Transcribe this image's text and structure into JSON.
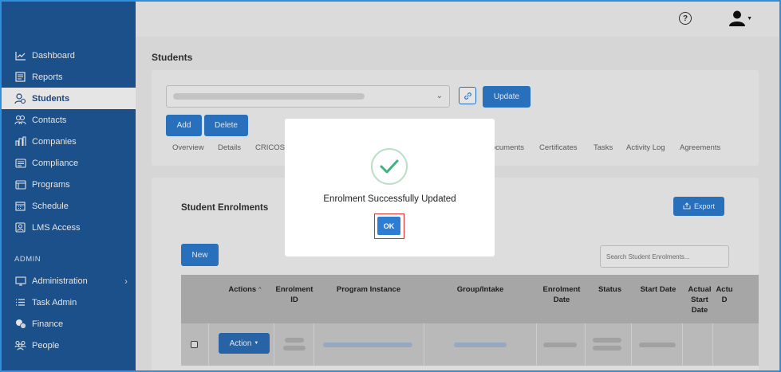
{
  "nav": {
    "items": [
      {
        "label": "Dashboard",
        "icon": "chart-line-icon"
      },
      {
        "label": "Reports",
        "icon": "report-icon"
      },
      {
        "label": "Students",
        "icon": "students-icon"
      },
      {
        "label": "Contacts",
        "icon": "contacts-icon"
      },
      {
        "label": "Companies",
        "icon": "companies-icon"
      },
      {
        "label": "Compliance",
        "icon": "compliance-icon"
      },
      {
        "label": "Programs",
        "icon": "programs-icon"
      },
      {
        "label": "Schedule",
        "icon": "schedule-icon"
      },
      {
        "label": "LMS Access",
        "icon": "lms-icon"
      }
    ],
    "active": "Students",
    "admin_label": "ADMIN",
    "admin_items": [
      {
        "label": "Administration",
        "icon": "administration-icon"
      },
      {
        "label": "Task Admin",
        "icon": "task-list-icon"
      },
      {
        "label": "Finance",
        "icon": "finance-icon"
      },
      {
        "label": "People",
        "icon": "people-icon"
      }
    ]
  },
  "topbar": {
    "help_symbol": "?"
  },
  "page": {
    "title": "Students"
  },
  "student_card": {
    "update_label": "Update",
    "add_label": "Add",
    "delete_label": "Delete",
    "tabs": [
      "Overview",
      "Details",
      "CRICOS",
      "Documents",
      "Certificates",
      "Tasks",
      "Activity Log",
      "Agreements"
    ]
  },
  "enrolments": {
    "title": "Student Enrolments",
    "export_label": "Export",
    "new_label": "New",
    "search_placeholder": "Search Student Enrolments...",
    "columns": [
      "Actions",
      "Enrolment ID",
      "Program Instance",
      "Group/Intake",
      "Enrolment Date",
      "Status",
      "Start Date",
      "Actual Start Date",
      "Actu D"
    ],
    "row_action_label": "Action"
  },
  "modal": {
    "message": "Enrolment Successfully Updated",
    "ok_label": "OK"
  },
  "colors": {
    "sidebar": "#1f5a9a",
    "primary": "#2d7dd2",
    "success_check": "#3fb27f",
    "highlight_outline": "#d93030"
  }
}
